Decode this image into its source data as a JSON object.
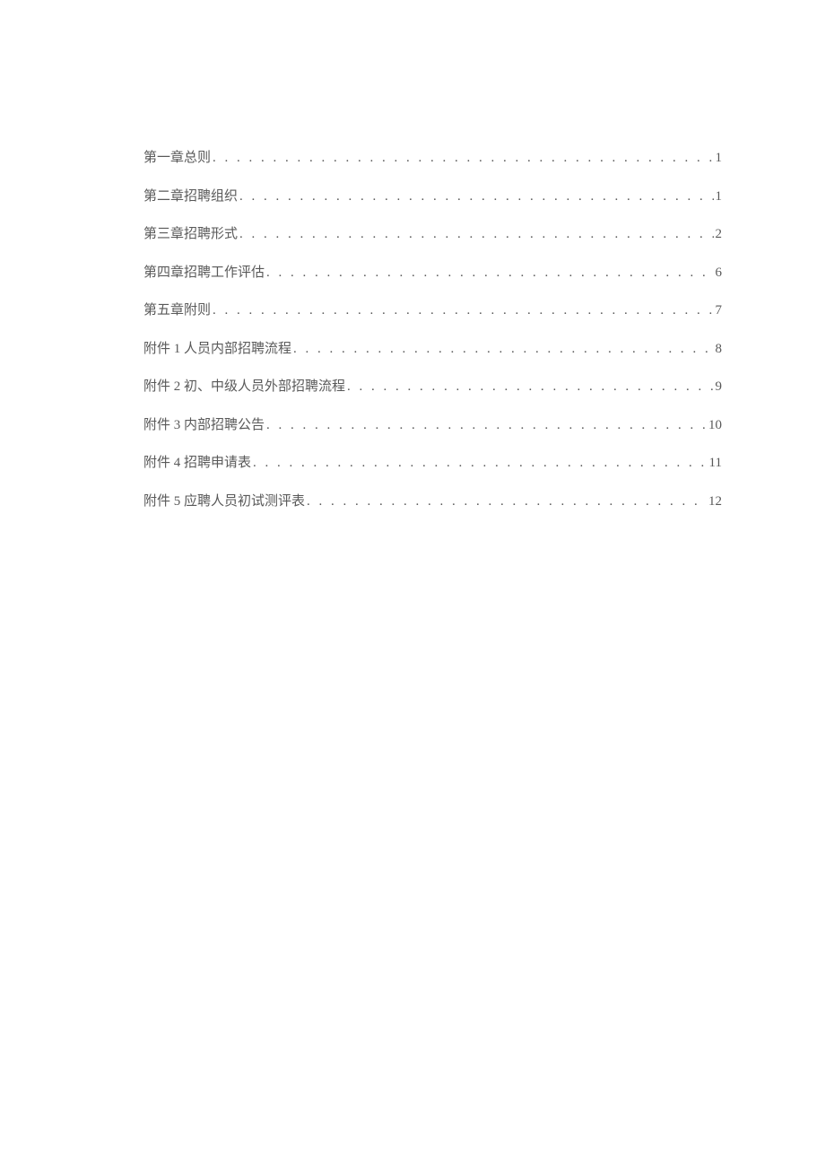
{
  "toc": {
    "entries": [
      {
        "title": "第一章总则",
        "page": "1"
      },
      {
        "title": "第二章招聘组织",
        "page": "1"
      },
      {
        "title": "第三章招聘形式",
        "page": "2"
      },
      {
        "title": "第四章招聘工作评估",
        "page": "6"
      },
      {
        "title": "第五章附则",
        "page": "7"
      },
      {
        "title": "附件 1 人员内部招聘流程",
        "page": "8"
      },
      {
        "title": "附件 2 初、中级人员外部招聘流程",
        "page": "9"
      },
      {
        "title": "附件 3 内部招聘公告",
        "page": "10"
      },
      {
        "title": "附件 4 招聘申请表",
        "page": "11"
      },
      {
        "title": "附件 5 应聘人员初试测评表",
        "page": "12"
      }
    ]
  },
  "dots": ". . . . . . . . . . . . . . . . . . . . . . . . . . . . . . . . . . . . . . . . . . . . . . . . . . . . . . . . . . . . . . . . . . . . . . . . . . . . . . . . . . . . . . . . . . . . . . . . . . . . . . . . . . . . . . . . . . . . . . . ."
}
